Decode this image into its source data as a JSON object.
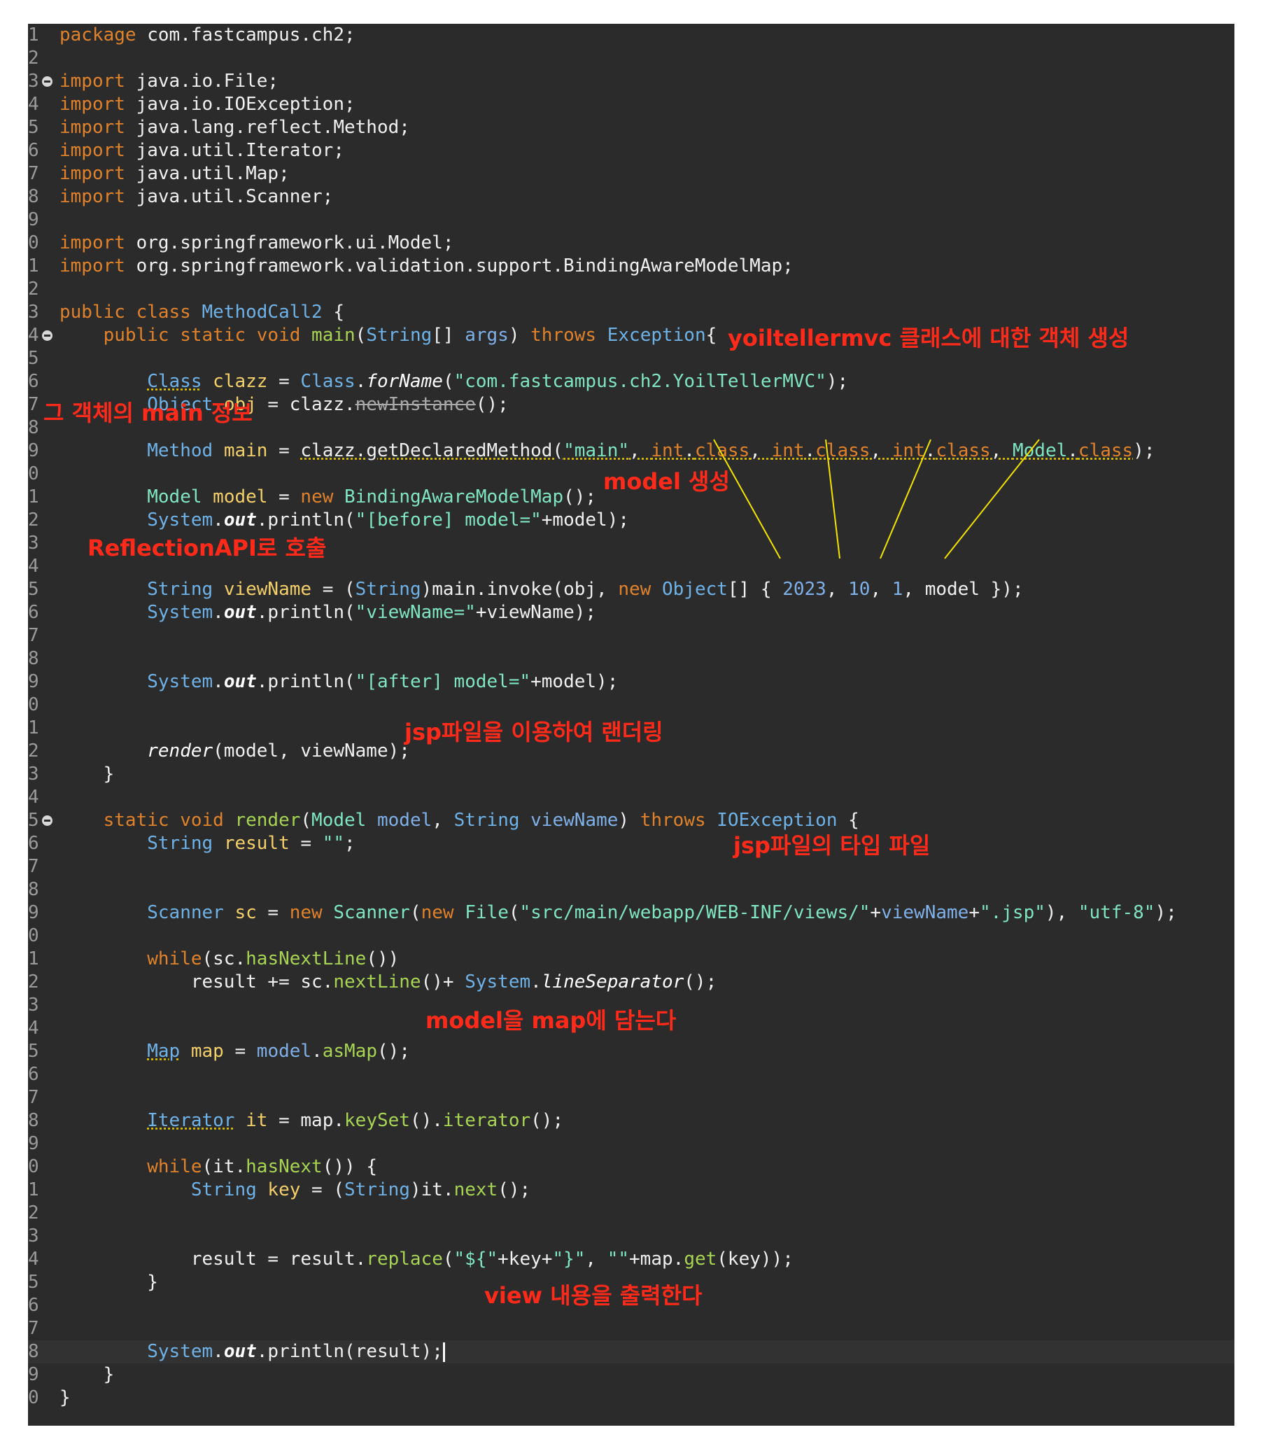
{
  "editor": {
    "lines": [
      {
        "n": "1",
        "html": "<span class=\"kw\">package</span> com.fastcampus.ch2;"
      },
      {
        "n": "2",
        "html": ""
      },
      {
        "n": "3",
        "fold": true,
        "html": "<span class=\"kw\">import</span> java.io.File;"
      },
      {
        "n": "4",
        "html": "<span class=\"kw\">import</span> java.io.IOException;"
      },
      {
        "n": "5",
        "html": "<span class=\"kw\">import</span> java.lang.reflect.Method;"
      },
      {
        "n": "6",
        "html": "<span class=\"kw\">import</span> java.util.Iterator;"
      },
      {
        "n": "7",
        "html": "<span class=\"kw\">import</span> java.util.Map;"
      },
      {
        "n": "8",
        "html": "<span class=\"kw\">import</span> java.util.Scanner;"
      },
      {
        "n": "9",
        "html": ""
      },
      {
        "n": "0",
        "html": "<span class=\"kw\">import</span> org.springframework.ui.Model;"
      },
      {
        "n": "1",
        "html": "<span class=\"kw\">import</span> org.springframework.validation.support.BindingAwareModelMap;"
      },
      {
        "n": "2",
        "html": ""
      },
      {
        "n": "3",
        "html": "<span class=\"kw\">public class</span> <span class=\"ty\">MethodCall2</span> {"
      },
      {
        "n": "4",
        "fold": true,
        "html": "    <span class=\"kw\">public static void</span> <span class=\"fn\">main</span>(<span class=\"ty\">String</span>[] <span class=\"nm\">args</span>) <span class=\"kw\">throws</span> <span class=\"ty\">Exception</span>{"
      },
      {
        "n": "5",
        "html": ""
      },
      {
        "n": "6",
        "html": "        <span class=\"ty wv\">Class</span> <span class=\"var\">clazz</span> = <span class=\"ty\">Class</span>.<span class=\"it\">forName</span>(<span class=\"st\">\"com.fastcampus.ch2.YoilTellerMVC\"</span>);"
      },
      {
        "n": "7",
        "html": "        <span class=\"ty\">Object</span> <span class=\"var\">obj</span> = clazz.<span class=\"strike wv\">newInstance</span>();"
      },
      {
        "n": "8",
        "html": ""
      },
      {
        "n": "9",
        "html": "        <span class=\"ty\">Method</span> <span class=\"var\">main</span> = <span class=\"wv\">clazz.getDeclaredMethod(<span class=\"st\">\"main\"</span>, <span class=\"kw\">int</span>.<span class=\"kw\">class</span>, <span class=\"kw\">int</span>.<span class=\"kw\">class</span>, <span class=\"kw\">int</span>.<span class=\"kw\">class</span>, <span class=\"cls\">Model</span>.<span class=\"kw\">class</span></span>);"
      },
      {
        "n": "0",
        "html": ""
      },
      {
        "n": "1",
        "html": "        <span class=\"cls\">Model</span> <span class=\"var\">model</span> = <span class=\"kw\">new</span> <span class=\"cls\">BindingAwareModelMap</span>();"
      },
      {
        "n": "2",
        "html": "        <span class=\"ty\">System</span>.<span class=\"sfn\"><b>out</b></span>.println(<span class=\"st\">\"[before] model=\"</span>+model);"
      },
      {
        "n": "3",
        "html": ""
      },
      {
        "n": "4",
        "html": ""
      },
      {
        "n": "5",
        "html": "        <span class=\"ty\">String</span> <span class=\"var\">viewName</span> = (<span class=\"ty\">String</span>)main.invoke(obj, <span class=\"kw\">new</span> <span class=\"ty\">Object</span>[] { <span class=\"nm\">2023</span>, <span class=\"nm\">10</span>, <span class=\"nm\">1</span>, model });"
      },
      {
        "n": "6",
        "html": "        <span class=\"ty\">System</span>.<span class=\"sfn\"><b>out</b></span>.println(<span class=\"st\">\"viewName=\"</span>+viewName);"
      },
      {
        "n": "7",
        "html": ""
      },
      {
        "n": "8",
        "html": ""
      },
      {
        "n": "9",
        "html": "        <span class=\"ty\">System</span>.<span class=\"sfn\"><b>out</b></span>.println(<span class=\"st\">\"[after] model=\"</span>+model);"
      },
      {
        "n": "0",
        "html": ""
      },
      {
        "n": "1",
        "html": ""
      },
      {
        "n": "2",
        "html": "        <span class=\"sfn\">render</span>(model, viewName);"
      },
      {
        "n": "3",
        "html": "    }"
      },
      {
        "n": "4",
        "html": ""
      },
      {
        "n": "5",
        "fold": true,
        "html": "    <span class=\"kw\">static void</span> <span class=\"fn\">render</span>(<span class=\"cls\">Model</span> <span class=\"nm\">model</span>, <span class=\"ty\">String</span> <span class=\"nm\">viewName</span>) <span class=\"kw\">throws</span> <span class=\"ty\">IOException</span> {"
      },
      {
        "n": "6",
        "html": "        <span class=\"ty\">String</span> <span class=\"var\">result</span> = <span class=\"st\">\"\"</span>;"
      },
      {
        "n": "7",
        "html": ""
      },
      {
        "n": "8",
        "html": ""
      },
      {
        "n": "9",
        "html": "        <span class=\"ty\">Scanner</span> <span class=\"var\">sc</span> = <span class=\"kw\">new</span> <span class=\"cls\">Scanner</span>(<span class=\"kw\">new</span> <span class=\"cls\">File</span>(<span class=\"st\">\"src/main/webapp/WEB-INF/views/\"</span>+<span class=\"nm\">viewName</span>+<span class=\"st\">\".jsp\"</span>), <span class=\"st\">\"utf-8\"</span>);"
      },
      {
        "n": "0",
        "html": ""
      },
      {
        "n": "1",
        "html": "        <span class=\"kw\">while</span>(sc.<span class=\"fn\">hasNextLine</span>())"
      },
      {
        "n": "2",
        "html": "            result += sc.<span class=\"fn\">nextLine</span>()+ <span class=\"ty\">System</span>.<span class=\"sfn\">lineSeparator</span>();"
      },
      {
        "n": "3",
        "html": ""
      },
      {
        "n": "4",
        "html": ""
      },
      {
        "n": "5",
        "html": "        <span class=\"ty wv\">Map</span> <span class=\"var\">map</span> = <span class=\"nm\">model</span>.<span class=\"fn\">asMap</span>();"
      },
      {
        "n": "6",
        "html": ""
      },
      {
        "n": "7",
        "html": ""
      },
      {
        "n": "8",
        "html": "        <span class=\"ty wv\">Iterator</span> <span class=\"var\">it</span> = map.<span class=\"fn\">keySet</span>().<span class=\"fn\">iterator</span>();"
      },
      {
        "n": "9",
        "html": ""
      },
      {
        "n": "0",
        "html": "        <span class=\"kw\">while</span>(it.<span class=\"fn\">hasNext</span>()) {"
      },
      {
        "n": "1",
        "html": "            <span class=\"ty\">String</span> <span class=\"var\">key</span> = (<span class=\"ty\">String</span>)it.<span class=\"fn\">next</span>();"
      },
      {
        "n": "2",
        "html": ""
      },
      {
        "n": "3",
        "html": ""
      },
      {
        "n": "4",
        "html": "            result = result.<span class=\"fn\">replace</span>(<span class=\"st\">\"${\"</span>+key+<span class=\"st\">\"}\"</span>, <span class=\"st\">\"\"</span>+map.<span class=\"fn\">get</span>(key));"
      },
      {
        "n": "5",
        "html": "        }"
      },
      {
        "n": "6",
        "html": ""
      },
      {
        "n": "7",
        "html": ""
      },
      {
        "n": "8",
        "current": true,
        "html": "        <span class=\"ty\">System</span>.<span class=\"sfn\"><b>out</b></span>.println(result);<span class=\"caret\"></span>"
      },
      {
        "n": "9",
        "html": "    }"
      },
      {
        "n": "0",
        "html": "}"
      }
    ]
  },
  "annotations": {
    "object_creation": "yoiltellermvc 클래스에 대한 객체 생성",
    "main_info": "그 객체의 main 정보",
    "model_create": "model 생성",
    "reflection_call": "ReflectionAPI로 호출",
    "jsp_render": "jsp파일을 이용하여 랜더링",
    "jsp_file_type": "jsp파일의 타입 파일",
    "model_to_map": "model을 map에 담는다",
    "print_view": "view 내용을 출력한다"
  },
  "colors": {
    "editor_bg": "#2b2b2b",
    "annotation": "#ff2a1a",
    "leader_line": "#f5e400"
  }
}
